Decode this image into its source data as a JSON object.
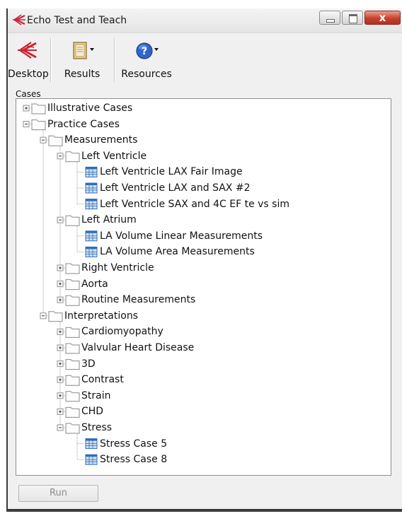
{
  "window": {
    "title": "Echo Test and Teach",
    "close_glyph": "x",
    "colors": {
      "accent_red": "#cc2233",
      "close_red": "#c8402e",
      "doc_blue": "#2f6fb6"
    }
  },
  "toolbar": {
    "items": [
      {
        "label": "Desktop",
        "icon": "echo-logo-icon"
      },
      {
        "label": "Results",
        "icon": "results-notebook-icon"
      },
      {
        "label": "Resources",
        "icon": "help-question-icon"
      }
    ]
  },
  "cases": {
    "label": "Cases",
    "tree": [
      {
        "label": "Illustrative Cases",
        "type": "folder",
        "depth": 0,
        "expanded": false
      },
      {
        "label": "Practice Cases",
        "type": "folder",
        "depth": 0,
        "expanded": true
      },
      {
        "label": "Measurements",
        "type": "folder",
        "depth": 1,
        "expanded": true
      },
      {
        "label": "Left Ventricle",
        "type": "folder",
        "depth": 2,
        "expanded": true
      },
      {
        "label": "Left Ventricle LAX Fair Image",
        "type": "case",
        "depth": 3
      },
      {
        "label": "Left Ventricle LAX and SAX #2",
        "type": "case",
        "depth": 3
      },
      {
        "label": "Left Ventricle SAX and 4C EF te vs sim",
        "type": "case",
        "depth": 3
      },
      {
        "label": "Left Atrium",
        "type": "folder",
        "depth": 2,
        "expanded": true
      },
      {
        "label": "LA Volume Linear Measurements",
        "type": "case",
        "depth": 3
      },
      {
        "label": "LA Volume Area Measurements",
        "type": "case",
        "depth": 3
      },
      {
        "label": "Right Ventricle",
        "type": "folder",
        "depth": 2,
        "expanded": false
      },
      {
        "label": "Aorta",
        "type": "folder",
        "depth": 2,
        "expanded": false
      },
      {
        "label": "Routine Measurements",
        "type": "folder",
        "depth": 2,
        "expanded": false
      },
      {
        "label": "Interpretations",
        "type": "folder",
        "depth": 1,
        "expanded": true
      },
      {
        "label": "Cardiomyopathy",
        "type": "folder",
        "depth": 2,
        "expanded": false
      },
      {
        "label": "Valvular Heart Disease",
        "type": "folder",
        "depth": 2,
        "expanded": false
      },
      {
        "label": "3D",
        "type": "folder",
        "depth": 2,
        "expanded": false
      },
      {
        "label": "Contrast",
        "type": "folder",
        "depth": 2,
        "expanded": false
      },
      {
        "label": "Strain",
        "type": "folder",
        "depth": 2,
        "expanded": false
      },
      {
        "label": "CHD",
        "type": "folder",
        "depth": 2,
        "expanded": false
      },
      {
        "label": "Stress",
        "type": "folder",
        "depth": 2,
        "expanded": true
      },
      {
        "label": "Stress Case 5",
        "type": "case",
        "depth": 3
      },
      {
        "label": "Stress Case 8",
        "type": "case",
        "depth": 3
      }
    ]
  },
  "run_button": {
    "label": "Run"
  }
}
